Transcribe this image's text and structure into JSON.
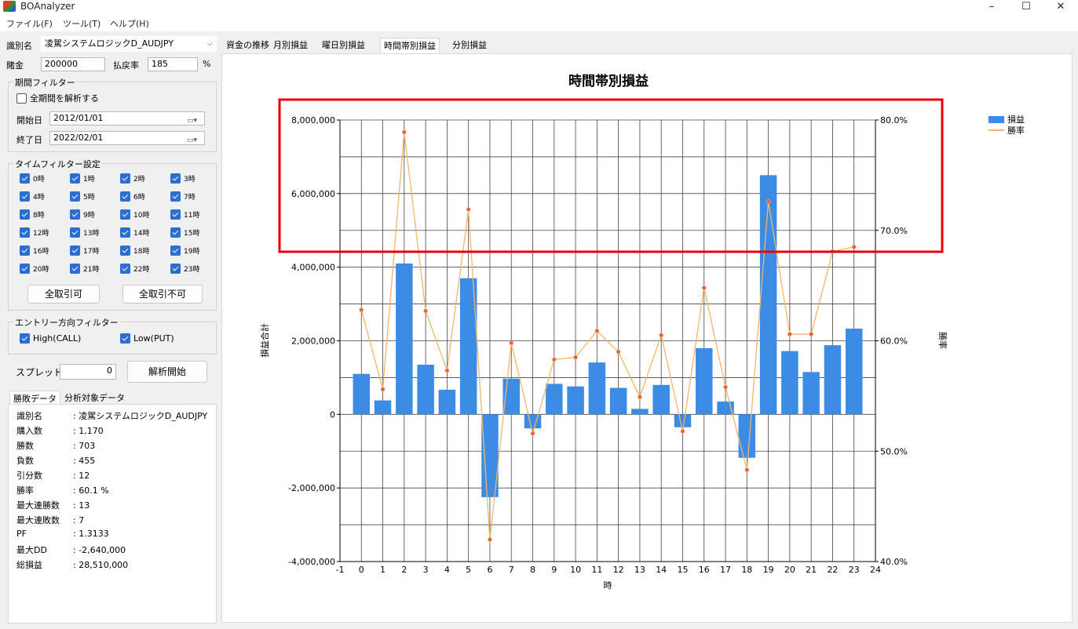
{
  "window": {
    "title": "BOAnalyzer",
    "minimize": "–",
    "maximize": "☐",
    "close": "✕"
  },
  "menu": {
    "file": "ファイル(F)",
    "tools": "ツール(T)",
    "help": "ヘルプ(H)"
  },
  "settings": {
    "name_label": "識別名",
    "name_value": "凌駕システムロジックD_AUDJPY",
    "bet_label": "賭金",
    "bet_value": "200000",
    "payout_label": "払戻率",
    "payout_value": "185",
    "percent": "%"
  },
  "period_filter": {
    "title": "期間フィルター",
    "all_period_label": "全期間を解析する",
    "all_period_checked": false,
    "start_label": "開始日",
    "start_value": "2012/01/01",
    "end_label": "終了日",
    "end_value": "2022/02/01"
  },
  "time_filter": {
    "title": "タイムフィルター設定",
    "hours": [
      "0時",
      "1時",
      "2時",
      "3時",
      "4時",
      "5時",
      "6時",
      "7時",
      "8時",
      "9時",
      "10時",
      "11時",
      "12時",
      "13時",
      "14時",
      "15時",
      "16時",
      "17時",
      "18時",
      "19時",
      "20時",
      "21時",
      "22時",
      "23時"
    ],
    "all_on_label": "全取引可",
    "all_off_label": "全取引不可"
  },
  "entry_filter": {
    "title": "エントリー方向フィルター",
    "high_label": "High(CALL)",
    "low_label": "Low(PUT)"
  },
  "spread": {
    "label": "スプレッド",
    "value": "0",
    "analyze_label": "解析開始"
  },
  "result_tabs": {
    "win_loss": "勝敗データ",
    "target": "分析対象データ"
  },
  "stats": [
    {
      "key": "識別名",
      "value": ": 凌駕システムロジックD_AUDJPY"
    },
    {
      "key": "購入数",
      "value": ": 1,170"
    },
    {
      "key": "勝数",
      "value": ": 703"
    },
    {
      "key": "負数",
      "value": ": 455"
    },
    {
      "key": "引分数",
      "value": ": 12"
    },
    {
      "key": "勝率",
      "value": ": 60.1 %"
    },
    {
      "key": "最大連勝数",
      "value": ": 13"
    },
    {
      "key": "最大連敗数",
      "value": ": 7"
    },
    {
      "key": "PF",
      "value": ": 1.3133"
    },
    {
      "key": "最大DD",
      "value": ": -2,640,000"
    },
    {
      "key": "総損益",
      "value": ": 28,510,000"
    }
  ],
  "chart_tabs": [
    "資金の推移",
    "月別損益",
    "曜日別損益",
    "時間帯別損益",
    "分別損益"
  ],
  "active_chart_tab": 3,
  "colors": {
    "bar": "#3c8ce6",
    "line": "#f5b56a",
    "marker": "#e8603c",
    "highlight": "#e60000"
  },
  "chart_data": {
    "type": "bar",
    "title": "時間帯別損益",
    "xlabel": "時",
    "ylabel": "損益合計",
    "y2label": "勝率",
    "xlim": [
      -1,
      24
    ],
    "ylim": [
      -4000000,
      8000000
    ],
    "y2lim": [
      40,
      80
    ],
    "x_ticks": [
      "-1",
      "0",
      "1",
      "2",
      "3",
      "4",
      "5",
      "6",
      "7",
      "8",
      "9",
      "10",
      "11",
      "12",
      "13",
      "14",
      "15",
      "16",
      "17",
      "18",
      "19",
      "20",
      "21",
      "22",
      "23",
      "24"
    ],
    "y_ticks": [
      "-4,000,000",
      "-2,000,000",
      "0",
      "2,000,000",
      "4,000,000",
      "6,000,000",
      "8,000,000"
    ],
    "y2_ticks": [
      "40.0%",
      "50.0%",
      "60.0%",
      "70.0%",
      "80.0%"
    ],
    "x": [
      0,
      1,
      2,
      3,
      4,
      5,
      6,
      7,
      8,
      9,
      10,
      11,
      12,
      13,
      14,
      15,
      16,
      17,
      18,
      19,
      20,
      21,
      22,
      23
    ],
    "series": [
      {
        "name": "損益",
        "type": "bar",
        "values": [
          1100000,
          380000,
          4100000,
          1350000,
          670000,
          3700000,
          -2250000,
          970000,
          -380000,
          830000,
          760000,
          1410000,
          720000,
          150000,
          800000,
          -350000,
          1800000,
          350000,
          -1180000,
          6500000,
          1720000,
          1150000,
          1880000,
          2330000
        ]
      },
      {
        "name": "勝率",
        "type": "line",
        "axis": "y2",
        "values": [
          62.8,
          55.6,
          78.9,
          62.7,
          57.3,
          71.9,
          42.0,
          59.8,
          51.6,
          58.3,
          58.5,
          60.9,
          59.0,
          54.9,
          60.5,
          51.8,
          64.8,
          55.8,
          48.3,
          72.6,
          60.6,
          60.6,
          68.1,
          68.5
        ]
      }
    ],
    "legend": "top-right",
    "grid": true
  }
}
